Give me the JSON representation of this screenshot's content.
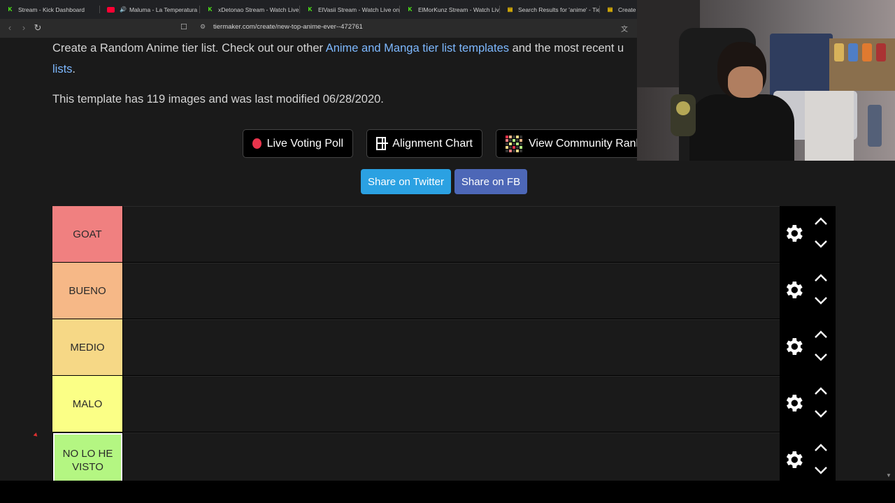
{
  "browser": {
    "tabs": [
      {
        "icon": "kick-icon",
        "title": "Stream - Kick Dashboard"
      },
      {
        "icon": "youtube-icon",
        "title": "Maluma - La Temperatura (",
        "audio": true
      },
      {
        "icon": "kick-icon",
        "title": "xDetonao Stream - Watch Live"
      },
      {
        "icon": "kick-icon",
        "title": "ElVasii Stream - Watch Live on"
      },
      {
        "icon": "kick-icon",
        "title": "ElMorKunz Stream - Watch Live"
      },
      {
        "icon": "tiermaker-icon",
        "title": "Search Results for 'anime' - Tie"
      },
      {
        "icon": "tiermaker-icon",
        "title": "Create a"
      }
    ],
    "url": "tiermaker.com/create/new-top-anime-ever--472761"
  },
  "page": {
    "desc_prefix": "Create a Random Anime tier list. Check out our other ",
    "desc_link": "Anime and Manga tier list templates",
    "desc_mid": " and the most recent u",
    "desc_link2": "lists",
    "desc_end": ".",
    "info": "This template has 119 images and was last modified 06/28/2020.",
    "buttons": {
      "live_poll": "Live Voting Poll",
      "alignment": "Alignment Chart",
      "community": "View Community Rank"
    },
    "share": {
      "twitter": "Share on Twitter",
      "facebook": "Share on FB"
    }
  },
  "tiers": [
    {
      "label": "GOAT",
      "color": "#f08080"
    },
    {
      "label": "BUENO",
      "color": "#f6b887"
    },
    {
      "label": "MEDIO",
      "color": "#f6d886"
    },
    {
      "label": "MALO",
      "color": "#fbff86"
    },
    {
      "label": "NO LO HE VISTO",
      "color": "#b4f682"
    }
  ],
  "colors": {
    "twitter": "#2ba1e2",
    "facebook": "#4d67b7",
    "link": "#7db8ff",
    "live_dot": "#e8344c"
  }
}
